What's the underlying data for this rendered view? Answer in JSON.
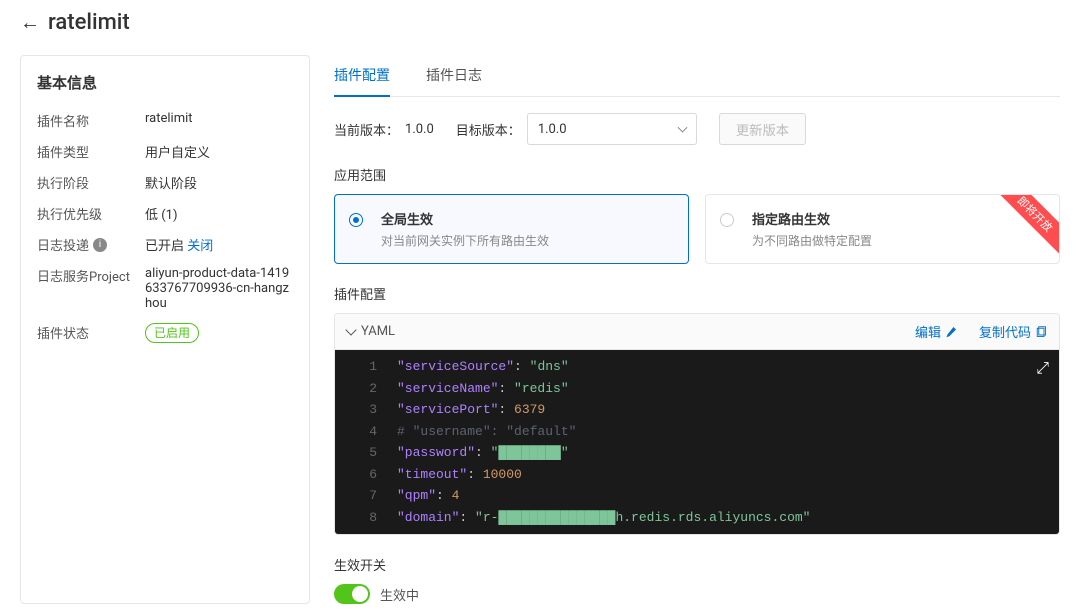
{
  "header": {
    "title": "ratelimit"
  },
  "sidebar": {
    "section_title": "基本信息",
    "rows": {
      "name_label": "插件名称",
      "name_value": "ratelimit",
      "type_label": "插件类型",
      "type_value": "用户自定义",
      "phase_label": "执行阶段",
      "phase_value": "默认阶段",
      "priority_label": "执行优先级",
      "priority_value": "低 (1)",
      "log_delivery_label": "日志投递",
      "log_delivery_on": "已开启",
      "log_delivery_action": "关闭",
      "log_project_label": "日志服务Project",
      "log_project_value": "aliyun-product-data-1419633767709936-cn-hangzhou",
      "status_label": "插件状态",
      "status_badge": "已启用"
    }
  },
  "tabs": {
    "config": "插件配置",
    "logs": "插件日志"
  },
  "version": {
    "current_label": "当前版本：",
    "current_value": "1.0.0",
    "target_label": "目标版本：",
    "target_value": "1.0.0",
    "update_btn": "更新版本"
  },
  "scope": {
    "label": "应用范围",
    "global_title": "全局生效",
    "global_desc": "对当前网关实例下所有路由生效",
    "route_title": "指定路由生效",
    "route_desc": "为不同路由做特定配置",
    "ribbon": "即将开放"
  },
  "code": {
    "section_label": "插件配置",
    "format": "YAML",
    "edit_action": "编辑",
    "copy_action": "复制代码",
    "lines": [
      {
        "k": "serviceSource",
        "v": "dns",
        "t": "str"
      },
      {
        "k": "serviceName",
        "v": "redis",
        "t": "str"
      },
      {
        "k": "servicePort",
        "v": "6379",
        "t": "num"
      },
      {
        "comment": "# \"username\": \"default\""
      },
      {
        "k": "password",
        "v": "████████",
        "t": "str"
      },
      {
        "k": "timeout",
        "v": "10000",
        "t": "num"
      },
      {
        "k": "qpm",
        "v": "4",
        "t": "num"
      },
      {
        "k": "domain",
        "v": "r-███████████████h.redis.rds.aliyuncs.com",
        "t": "str"
      }
    ]
  },
  "switch": {
    "label": "生效开关",
    "on_text": "生效中"
  }
}
